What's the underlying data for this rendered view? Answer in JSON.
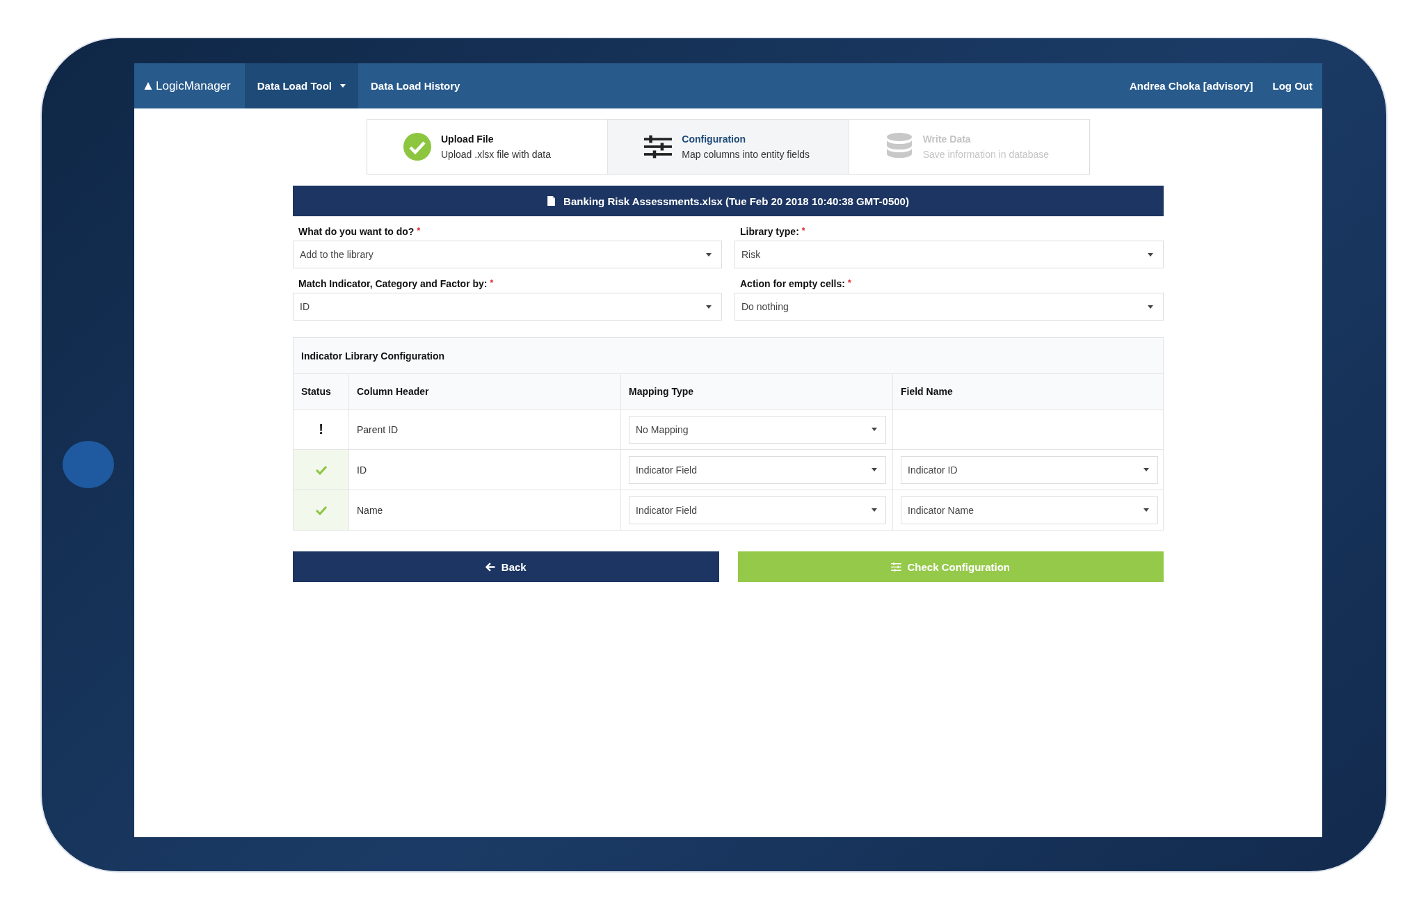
{
  "navbar": {
    "brand": "LogicManager",
    "items": [
      {
        "label": "Data Load Tool",
        "selected": true,
        "dropdown": true
      },
      {
        "label": "Data Load History",
        "selected": false,
        "dropdown": false
      }
    ],
    "user": "Andrea Choka [advisory]",
    "logout": "Log Out"
  },
  "steps": [
    {
      "title": "Upload File",
      "subtitle": "Upload .xlsx file with data",
      "selected": false,
      "disabled": false,
      "kind": "check"
    },
    {
      "title": "Configuration",
      "subtitle": "Map columns into entity fields",
      "selected": true,
      "disabled": false,
      "kind": "sliders"
    },
    {
      "title": "Write Data",
      "subtitle": "Save information in database",
      "selected": false,
      "disabled": true,
      "kind": "database"
    }
  ],
  "file_banner": "Banking Risk Assessments.xlsx (Tue Feb 20 2018 10:40:38 GMT-0500)",
  "form_fields": [
    {
      "label": "What do you want to do?",
      "marker": "*",
      "value": "Add to the library"
    },
    {
      "label": "Library type:",
      "marker": "*",
      "value": "Risk"
    },
    {
      "label": "Match Indicator, Category and Factor by:",
      "marker": "*",
      "value": "ID"
    },
    {
      "label": "Action for empty cells:",
      "marker": "*",
      "value": "Do nothing"
    }
  ],
  "table": {
    "title": "Indicator Library Configuration",
    "columns": [
      "Status",
      "Column Header",
      "Mapping Type",
      "Field Name"
    ],
    "rows": [
      {
        "kind": "warning",
        "status_text": "!",
        "column_header": "Parent ID",
        "mapping_type": "No Mapping"
      },
      {
        "kind": "ok",
        "column_header": "ID",
        "mapping_type": "Indicator Field",
        "field_name": "Indicator ID"
      },
      {
        "kind": "ok",
        "column_header": "Name",
        "mapping_type": "Indicator Field",
        "field_name": "Indicator Name"
      }
    ]
  },
  "buttons": [
    {
      "label": "Back",
      "kind": "back"
    },
    {
      "label": "Check Configuration",
      "kind": "check"
    }
  ]
}
